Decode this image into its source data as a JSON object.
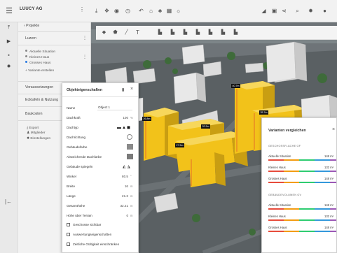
{
  "topbar": {
    "brand": "LUUCY AG",
    "menu_icon": "hamburger-menu-icon"
  },
  "sidebar": {
    "projects": "Projekte",
    "luzern": "Luzern",
    "variants": [
      {
        "label": "Aktuelle Situation"
      },
      {
        "label": "Kleines Haus"
      },
      {
        "label": "Grosses Haus"
      }
    ],
    "create_variant": "Variante erstellen",
    "sections": [
      {
        "label": "Voraussetzungen"
      },
      {
        "label": "Ecktafeln & Nutzung"
      },
      {
        "label": "Baukosten"
      }
    ],
    "actions": [
      {
        "label": "Export"
      },
      {
        "label": "Mitglieder"
      },
      {
        "label": "Einstellungen"
      }
    ]
  },
  "properties": {
    "title": "Objekteigenschaften",
    "rows": [
      {
        "label": "Name",
        "value": "Object 1",
        "unit": ""
      },
      {
        "label": "Dachkraft",
        "value": "100",
        "unit": "%"
      },
      {
        "label": "Dachtyp",
        "value": "",
        "unit": ""
      },
      {
        "label": "Dachrichtung",
        "value": "",
        "unit": ""
      },
      {
        "label": "Gebäudefarbe",
        "value": "",
        "unit": ""
      },
      {
        "label": "Abweichende Dachfarbe",
        "value": "",
        "unit": ""
      },
      {
        "label": "Gebäude spiegeln",
        "value": "",
        "unit": ""
      },
      {
        "label": "Winkel",
        "value": "80.5",
        "unit": "°"
      },
      {
        "label": "Breite",
        "value": "16",
        "unit": "m"
      },
      {
        "label": "Länge",
        "value": "21.3",
        "unit": "m"
      },
      {
        "label": "Gesamthöhe",
        "value": "32.21",
        "unit": "m"
      },
      {
        "label": "Höhe über Terrain",
        "value": "0",
        "unit": "m"
      }
    ],
    "checkboxes": [
      {
        "label": "Geschosse sichtbar"
      },
      {
        "label": "Auswertungseigenschaften"
      },
      {
        "label": "Zeitliche Gültigkeit einschränken"
      }
    ],
    "building_color": "#8a8a8a",
    "roof_color": "#7a7a7a"
  },
  "compare": {
    "title": "Varianten vergleichen",
    "sections": [
      {
        "heading": "GESCHOSSFLÄCHE GF",
        "rows": [
          {
            "name": "Aktuelle Situation",
            "value": "148 m²"
          },
          {
            "name": "Kleines Haus",
            "value": "132 m²"
          },
          {
            "name": "Grosses Haus",
            "value": "148 m²"
          }
        ]
      },
      {
        "heading": "GEBÄUDEVOLUMEN GV",
        "rows": [
          {
            "name": "Aktuelle Situation",
            "value": "148 m²"
          },
          {
            "name": "Kleines Haus",
            "value": "132 m²"
          },
          {
            "name": "Grosses Haus",
            "value": "148 m²"
          }
        ]
      }
    ],
    "bar_colors": [
      "#e74c3c",
      "#f39c12",
      "#2ecc71",
      "#3498db",
      "#9b59b6"
    ]
  },
  "map": {
    "labels": [
      {
        "text": "40.7m"
      },
      {
        "text": "35.7m"
      },
      {
        "text": "26.8m"
      },
      {
        "text": "32.2m"
      },
      {
        "text": "27.5m"
      }
    ],
    "building_highlight": "#f2c21a",
    "building_neutral": "#e6e6e6"
  }
}
